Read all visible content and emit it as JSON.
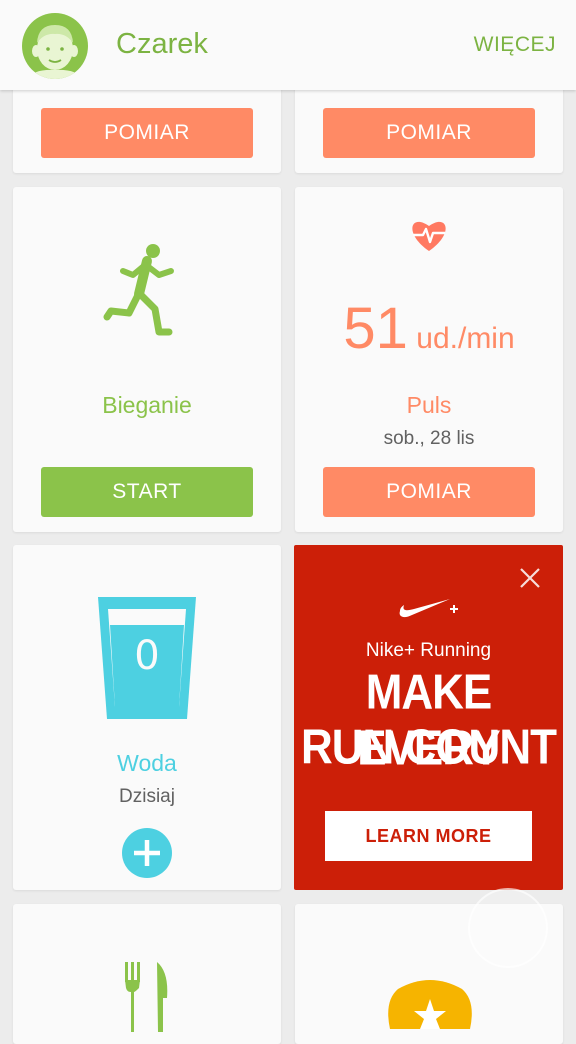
{
  "header": {
    "user_name": "Czarek",
    "more_label": "WIĘCEJ"
  },
  "top_cards": {
    "left_button": "POMIAR",
    "right_button": "POMIAR"
  },
  "running_card": {
    "title": "Bieganie",
    "button": "START",
    "icon": "running-person-icon",
    "color": "#8bc34a"
  },
  "pulse_card": {
    "value": "51",
    "unit": "ud./min",
    "title": "Puls",
    "date": "sob., 28 lis",
    "button": "POMIAR",
    "icon": "heart-rate-icon",
    "color": "#ff8a65"
  },
  "water_card": {
    "count": "0",
    "title": "Woda",
    "subtitle": "Dzisiaj",
    "icon": "water-glass-icon",
    "color": "#4dd0e1"
  },
  "ad": {
    "brand": "Nike+ Running",
    "headline_line1": "MAKE EVERY",
    "headline_line2": "RUN COUNT",
    "cta": "LEARN MORE",
    "color": "#cc1f08"
  },
  "bottom_cards": {
    "left_icon": "fork-knife-icon",
    "right_icon": "star-badge-icon"
  }
}
